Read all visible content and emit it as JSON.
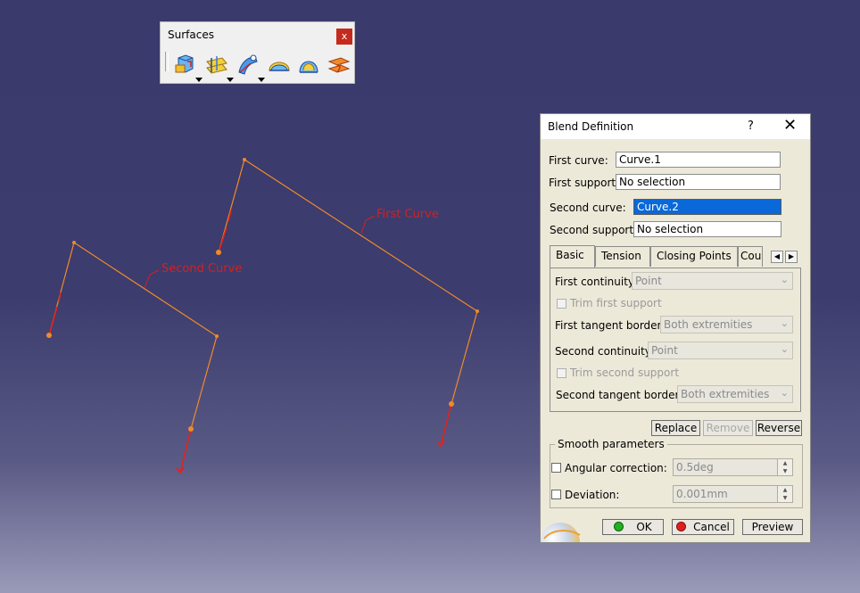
{
  "viewport": {
    "labels": {
      "first_curve": "First Curve",
      "second_curve": "Second Curve"
    }
  },
  "toolbar": {
    "title": "Surfaces",
    "close": "x",
    "icons": [
      "extrude-surface-icon",
      "offset-surface-icon",
      "sweep-surface-icon",
      "fill-surface-icon",
      "multi-section-surface-icon",
      "blend-surface-icon"
    ]
  },
  "dialog": {
    "title": "Blend Definition",
    "help": "?",
    "close": "✕",
    "first_curve": {
      "label": "First curve:",
      "value": "Curve.1"
    },
    "first_support": {
      "label": "First support:",
      "value": "No selection"
    },
    "second_curve": {
      "label": "Second curve:",
      "value": "Curve.2"
    },
    "second_support": {
      "label": "Second support:",
      "value": "No selection"
    },
    "tabs": [
      "Basic",
      "Tension",
      "Closing Points",
      "Cou"
    ],
    "basic": {
      "first_continuity": {
        "label": "First continuity:",
        "value": "Point"
      },
      "trim_first_support": "Trim first support",
      "first_tangent_borders": {
        "label": "First tangent borders:",
        "value": "Both extremities"
      },
      "second_continuity": {
        "label": "Second continuity:",
        "value": "Point"
      },
      "trim_second_support": "Trim second support",
      "second_tangent_borders": {
        "label": "Second tangent borders:",
        "value": "Both extremities"
      }
    },
    "actions": {
      "replace": "Replace",
      "remove": "Remove",
      "reverse": "Reverse"
    },
    "smooth": {
      "title": "Smooth parameters",
      "angular": {
        "label": "Angular correction:",
        "value": "0.5deg"
      },
      "deviation": {
        "label": "Deviation:",
        "value": "0.001mm"
      }
    },
    "footer": {
      "ok": "OK",
      "cancel": "Cancel",
      "preview": "Preview"
    }
  }
}
